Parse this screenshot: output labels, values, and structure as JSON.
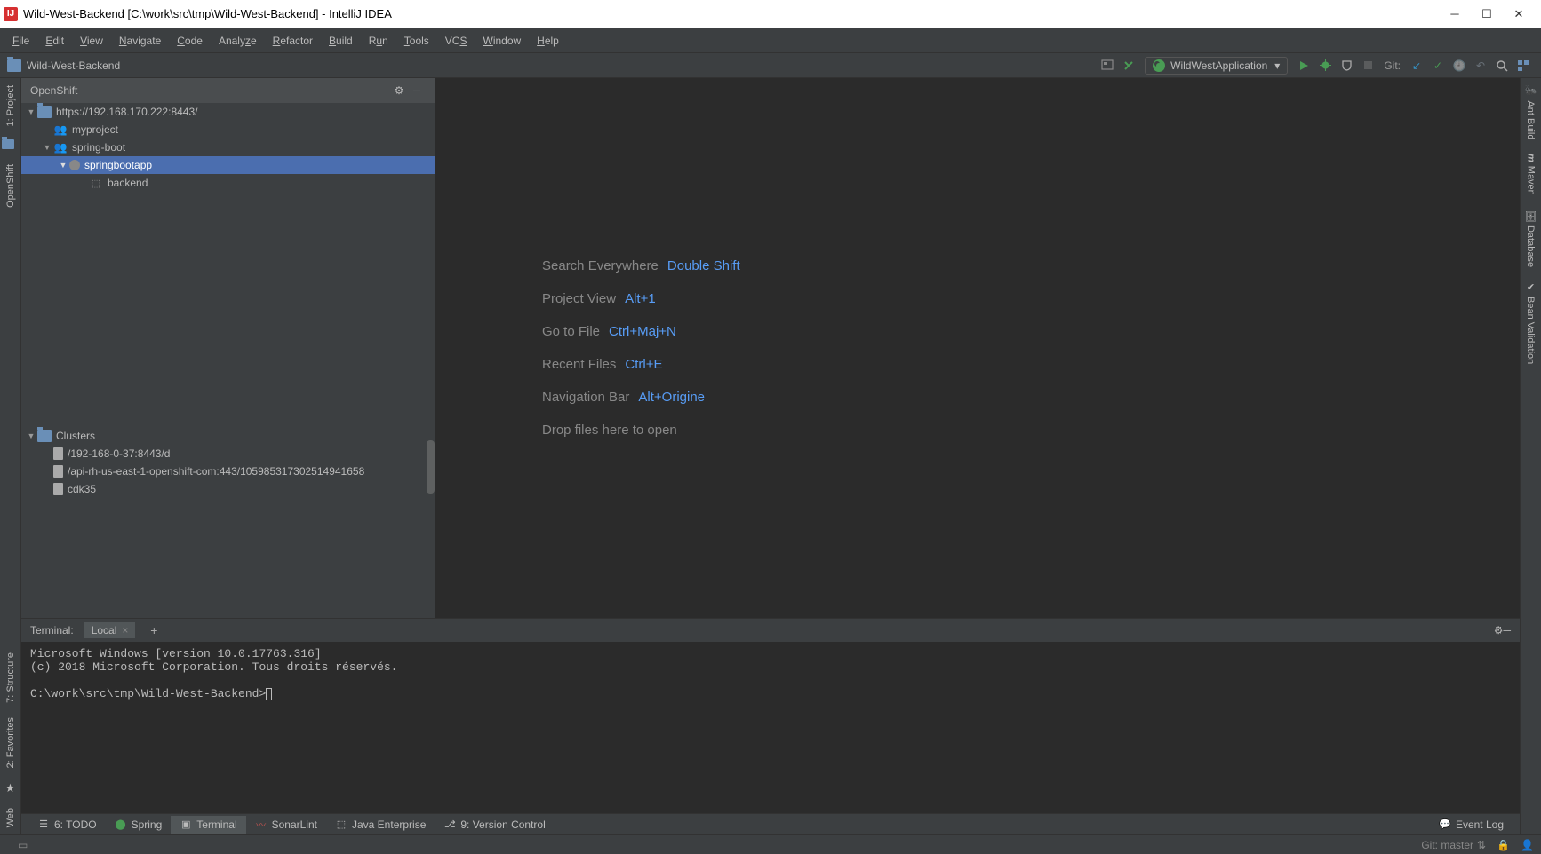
{
  "window": {
    "title": "Wild-West-Backend [C:\\work\\src\\tmp\\Wild-West-Backend] - IntelliJ IDEA"
  },
  "menu": [
    "File",
    "Edit",
    "View",
    "Navigate",
    "Code",
    "Analyze",
    "Refactor",
    "Build",
    "Run",
    "Tools",
    "VCS",
    "Window",
    "Help"
  ],
  "breadcrumb": "Wild-West-Backend",
  "toolbar": {
    "run_config": "WildWestApplication",
    "git_label": "Git:"
  },
  "panel": {
    "title": "OpenShift",
    "tree": {
      "url": "https://192.168.170.222:8443/",
      "myproject": "myproject",
      "springboot": "spring-boot",
      "springbootapp": "springbootapp",
      "backend": "backend"
    },
    "clusters": {
      "header": "Clusters",
      "items": [
        "/192-168-0-37:8443/d",
        "/api-rh-us-east-1-openshift-com:443/105985317302514941658",
        "cdk35"
      ]
    }
  },
  "editor_hints": [
    {
      "label": "Search Everywhere",
      "key": "Double Shift"
    },
    {
      "label": "Project View",
      "key": "Alt+1"
    },
    {
      "label": "Go to File",
      "key": "Ctrl+Maj+N"
    },
    {
      "label": "Recent Files",
      "key": "Ctrl+E"
    },
    {
      "label": "Navigation Bar",
      "key": "Alt+Origine"
    },
    {
      "label": "Drop files here to open",
      "key": ""
    }
  ],
  "terminal": {
    "tab_title": "Terminal:",
    "tab_name": "Local",
    "line1": "Microsoft Windows [version 10.0.17763.316]",
    "line2": "(c) 2018 Microsoft Corporation. Tous droits réservés.",
    "prompt": "C:\\work\\src\\tmp\\Wild-West-Backend>"
  },
  "bottom_tabs": {
    "todo": "6: TODO",
    "spring": "Spring",
    "terminal": "Terminal",
    "sonarlint": "SonarLint",
    "java_ee": "Java Enterprise",
    "vcs": "9: Version Control",
    "event_log": "Event Log"
  },
  "status": {
    "git": "Git: master"
  },
  "left_tabs": {
    "project": "1: Project",
    "openshift": "OpenShift",
    "structure": "7: Structure",
    "favorites": "2: Favorites",
    "web": "Web"
  },
  "right_tabs": {
    "ant": "Ant Build",
    "maven": "Maven",
    "database": "Database",
    "bean": "Bean Validation"
  }
}
